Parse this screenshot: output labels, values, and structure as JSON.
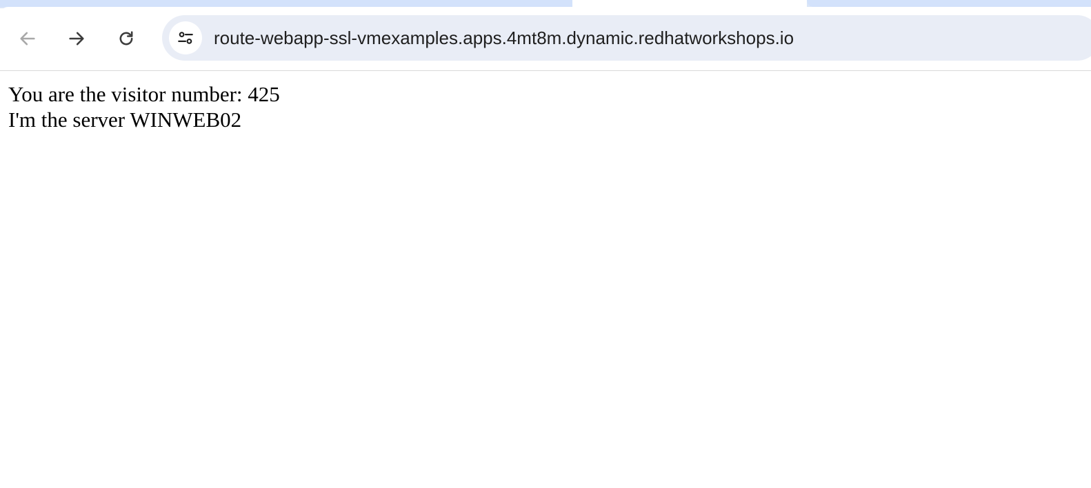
{
  "browser": {
    "address_bar": {
      "url": "route-webapp-ssl-vmexamples.apps.4mt8m.dynamic.redhatworkshops.io"
    },
    "icons": {
      "back": "arrow-left-icon",
      "forward": "arrow-right-icon",
      "reload": "reload-icon",
      "site_info": "tune-icon"
    }
  },
  "page": {
    "line1": "You are the visitor number: 425",
    "line2": "I'm the server WINWEB02"
  }
}
